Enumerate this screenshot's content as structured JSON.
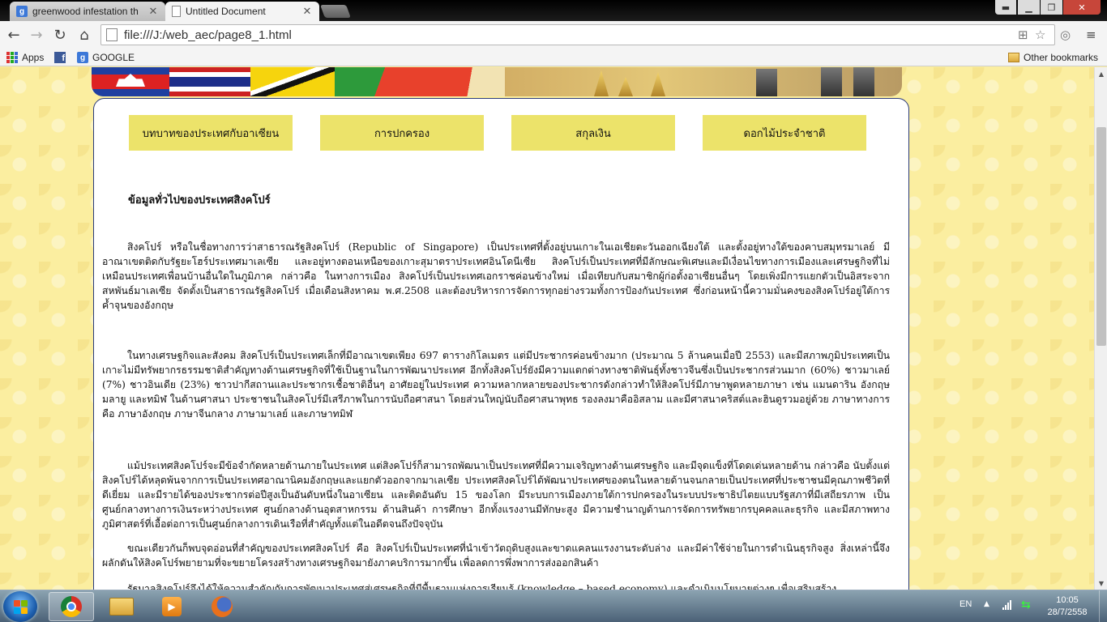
{
  "browser": {
    "tabs": [
      {
        "title": "greenwood infestation th",
        "favicon": "google-g-icon",
        "active": false
      },
      {
        "title": "Untitled Document",
        "favicon": "page-icon",
        "active": true
      }
    ],
    "address": "file:///J:/web_aec/page8_1.html",
    "bookmarks": {
      "apps": "Apps",
      "google": "GOOGLE",
      "other": "Other bookmarks"
    }
  },
  "page": {
    "menu": [
      {
        "label": "บทบาทของประเทศกับอาเซียน"
      },
      {
        "label": "การปกครอง"
      },
      {
        "label": "สกุลเงิน"
      },
      {
        "label": "ดอกไม้ประจำชาติ"
      }
    ],
    "heading": "ข้อมูลทั่วไปของประเทศสิงคโปร์",
    "paragraphs": [
      "สิงคโปร์ หรือในชื่อทางการว่าสาธารณรัฐสิงคโปร์ (Republic of Singapore) เป็นประเทศที่ตั้งอยู่บนเกาะในเอเชียตะวันออกเฉียงใต้ และตั้งอยู่ทางใต้ของคาบสมุทรมาเลย์ มีอาณาเขตติดกับรัฐยะโฮร์ประเทศมาเลเซีย และอยู่ทางตอนเหนือของเกาะสุมาตราประเทศอินโดนีเซีย สิงคโปร์เป็นประเทศที่มีลักษณะพิเศษและมีเงื่อนไขทางการเมืองและเศรษฐกิจที่ไม่เหมือนประเทศเพื่อนบ้านอื่นใดในภูมิภาค กล่าวคือ ในทางการเมือง สิงคโปร์เป็นประเทศเอกราชค่อนข้างใหม่ เมื่อเทียบกับสมาชิกผู้ก่อตั้งอาเซียนอื่นๆ โดยเพิ่งมีการแยกตัวเป็นอิสระจากสหพันธ์มาเลเซีย จัดตั้งเป็นสาธารณรัฐสิงคโปร์ เมื่อเดือนสิงหาคม พ.ศ.2508 และต้องบริหารการจัดการทุกอย่างรวมทั้งการป้องกันประเทศ ซึ่งก่อนหน้านี้ความมั่นคงของสิงคโปร์อยู่ใต้การค้ำจุนของอังกฤษ",
      "ในทางเศรษฐกิจและสังคม สิงคโปร์เป็นประเทศเล็กที่มีอาณาเขตเพียง 697 ตารางกิโลเมตร แต่มีประชากรค่อนข้างมาก (ประมาณ 5 ล้านคนเมื่อปี 2553) และมีสภาพภูมิประเทศเป็นเกาะไม่มีทรัพยากรธรรมชาติสำคัญทางด้านเศรษฐกิจที่ใช้เป็นฐานในการพัฒนาประเทศ อีกทั้งสิงคโปร์ยังมีความแตกต่างทางชาติพันธุ์ทั้งชาวจีนซึ่งเป็นประชากรส่วนมาก (60%) ชาวมาเลย์ (7%) ชาวอินเดีย (23%) ชาวปากีสถานและประชากรเชื้อชาติอื่นๆ อาศัยอยู่ในประเทศ ความหลากหลายของประชากรดังกล่าวทำให้สิงคโปร์มีภาษาพูดหลายภาษา เช่น แมนดาริน อังกฤษ มลายู และทมิฬ ในด้านศาสนา ประชาชนในสิงคโปร์มีเสรีภาพในการนับถือศาสนา โดยส่วนใหญ่นับถือศาสนาพุทธ รองลงมาคืออิสลาม และมีศาสนาคริสต์และฮินดูรวมอยู่ด้วย ภาษาทางการ คือ ภาษาอังกฤษ ภาษาจีนกลาง ภาษามาเลย์ และภาษาทมิฬ",
      "แม้ประเทศสิงคโปร์จะมีข้อจำกัดหลายด้านภายในประเทศ แต่สิงคโปร์ก็สามารถพัฒนาเป็นประเทศที่มีความเจริญทางด้านเศรษฐกิจ และมีจุดแข็งที่โดดเด่นหลายด้าน กล่าวคือ นับตั้งแต่สิงคโปร์ได้หลุดพ้นจากการเป็นประเทศอาณานิคมอังกฤษและแยกตัวออกจากมาเลเซีย ประเทศสิงคโปร์ได้พัฒนาประเทศของตนในหลายด้านจนกลายเป็นประเทศที่ประชาชนมีคุณภาพชีวิตที่ดีเยี่ยม และมีรายได้ของประชากรต่อปีสูงเป็นอันดับหนึ่งในอาเซียน และติดอันดับ 15 ของโลก มีระบบการเมืองภายใต้การปกครองในระบบประชาธิปไตยแบบรัฐสภาที่มีเสถียรภาพ เป็นศูนย์กลางทางการเงินระหว่างประเทศ ศูนย์กลางด้านอุตสาหกรรม ด้านสินค้า การศึกษา อีกทั้งแรงงานมีทักษะสูง มีความชำนาญด้านการจัดการทรัพยากรบุคคลและธุรกิจ และมีสภาพทางภูมิศาสตร์ที่เอื้อต่อการเป็นศูนย์กลางการเดินเรือที่สำคัญทั้งแต่ในอดีตจนถึงปัจจุบัน",
      "ขณะเดียวกันก็พบจุดอ่อนที่สำคัญของประเทศสิงคโปร์ คือ สิงคโปร์เป็นประเทศที่นำเข้าวัตถุดิบสูงและขาดแคลนแรงงานระดับล่าง และมีค่าใช้จ่ายในการดำเนินธุรกิจสูง สิ่งเหล่านี้จึงผลักดันให้สิงคโปร์พยายามที่จะขยายโครงสร้างทางเศรษฐกิจมายังภาคบริการมากขึ้น เพื่อลดการพึ่งพาการส่งออกสินค้า",
      "รัฐบาลสิงคโปร์จึงได้ให้ความสำคัญกับการพัฒนาประเทศสู่เศรษฐกิจที่มีพื้นฐานแห่งการเรียนรู้ (knowledge – based economy) และดำเนินนโยบายต่างๆ เพื่อเสริมสร้าง"
    ]
  },
  "taskbar": {
    "language": "EN",
    "time": "10:05",
    "date": "28/7/2558",
    "apps": [
      "chrome-icon",
      "explorer-icon",
      "media-player-icon",
      "firefox-icon"
    ]
  },
  "colors": {
    "menu_button": "#ece36a",
    "panel_border": "#2a3a7a",
    "page_background": "#fbeea0"
  }
}
